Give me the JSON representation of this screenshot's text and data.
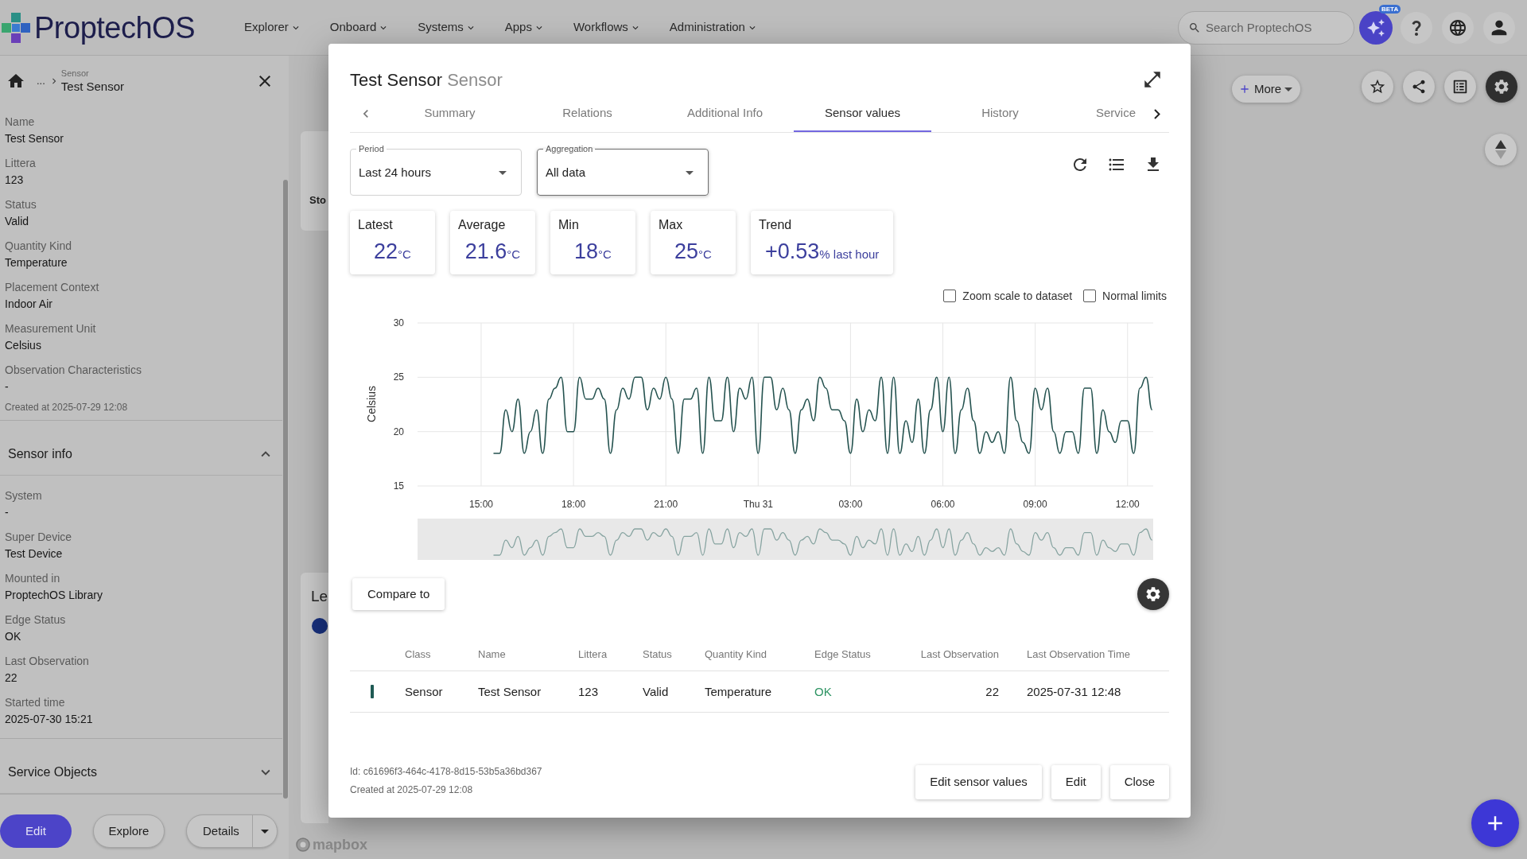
{
  "top_bar": {
    "logo": "ProptechOS",
    "nav": [
      "Explorer",
      "Onboard",
      "Systems",
      "Apps",
      "Workflows",
      "Administration"
    ],
    "search": {
      "placeholder": "Search ProptechOS"
    },
    "ai_badge": "BETA"
  },
  "side_panel": {
    "breadcrumb": {
      "ellipsis": "...",
      "type": "Sensor",
      "title": "Test Sensor"
    },
    "fields": [
      {
        "label": "Name",
        "value": "Test Sensor"
      },
      {
        "label": "Littera",
        "value": "123"
      },
      {
        "label": "Status",
        "value": "Valid"
      },
      {
        "label": "Quantity Kind",
        "value": "Temperature"
      },
      {
        "label": "Placement Context",
        "value": "Indoor Air"
      },
      {
        "label": "Measurement Unit",
        "value": "Celsius"
      },
      {
        "label": "Observation Characteristics",
        "value": "-"
      }
    ],
    "created": "Created at 2025-07-29 12:08",
    "sections": [
      {
        "title": "Sensor info",
        "expanded": true,
        "fields": [
          {
            "label": "System",
            "value": "-"
          },
          {
            "label": "Super Device",
            "value": "Test Device"
          },
          {
            "label": "Mounted in",
            "value": "ProptechOS Library"
          },
          {
            "label": "Edge Status",
            "value": "OK"
          },
          {
            "label": "Last Observation",
            "value": "22"
          },
          {
            "label": "Started time",
            "value": "2025-07-30 15:21"
          }
        ]
      },
      {
        "title": "Service Objects",
        "expanded": false
      }
    ],
    "buttons": [
      {
        "kind": "primary",
        "label": "Edit"
      },
      {
        "kind": "outline",
        "label": "Explore"
      },
      {
        "kind": "split",
        "label": "Details"
      }
    ]
  },
  "map": {
    "cards": [
      {
        "title": "Sto",
        "marker": false
      },
      {
        "title": "Le",
        "marker": true
      }
    ],
    "more_button": "More",
    "attribution": "mapbox"
  },
  "dialog": {
    "title": "Test Sensor",
    "subtitle": "Sensor",
    "tabs": [
      {
        "label": "Summary",
        "selected": false
      },
      {
        "label": "Relations",
        "selected": false
      },
      {
        "label": "Additional Info",
        "selected": false
      },
      {
        "label": "Sensor values",
        "selected": true
      },
      {
        "label": "History",
        "selected": false
      },
      {
        "label": "Service",
        "selected": false
      }
    ],
    "filters": [
      {
        "label": "Period",
        "value": "Last 24 hours",
        "focused": false
      },
      {
        "label": "Aggregation",
        "value": "All data",
        "focused": true
      }
    ],
    "stats": [
      {
        "label": "Latest",
        "value": "22",
        "unit": "°C"
      },
      {
        "label": "Average",
        "value": "21.6",
        "unit": "°C"
      },
      {
        "label": "Min",
        "value": "18",
        "unit": "°C"
      },
      {
        "label": "Max",
        "value": "25",
        "unit": "°C"
      },
      {
        "label": "Trend",
        "value": "+0.53",
        "unit": "% last hour"
      }
    ],
    "options": [
      {
        "label": "Zoom scale to dataset",
        "checked": false
      },
      {
        "label": "Normal limits",
        "checked": false
      }
    ],
    "chart_data": {
      "type": "line",
      "ylabel": "Celsius",
      "grid": true,
      "xlim": [
        "2025-07-30 12:56",
        "2025-07-31 12:50"
      ],
      "ylim": [
        15,
        30
      ],
      "yticks": [
        15,
        20,
        25,
        30
      ],
      "xticks": [
        {
          "value": "2025-07-30 15:00",
          "label": "15:00"
        },
        {
          "value": "2025-07-30 18:00",
          "label": "18:00"
        },
        {
          "value": "2025-07-30 21:00",
          "label": "21:00"
        },
        {
          "value": "2025-07-31 00:00",
          "label": "Thu 31"
        },
        {
          "value": "2025-07-31 03:00",
          "label": "03:00"
        },
        {
          "value": "2025-07-31 06:00",
          "label": "06:00"
        },
        {
          "value": "2025-07-31 09:00",
          "label": "09:00"
        },
        {
          "value": "2025-07-31 12:00",
          "label": "12:00"
        }
      ],
      "x": [
        "2025-07-30 15:24",
        "2025-07-30 15:36",
        "2025-07-30 15:48",
        "2025-07-30 16:00",
        "2025-07-30 16:12",
        "2025-07-30 16:24",
        "2025-07-30 16:36",
        "2025-07-30 16:48",
        "2025-07-30 17:00",
        "2025-07-30 17:12",
        "2025-07-30 17:24",
        "2025-07-30 17:36",
        "2025-07-30 17:48",
        "2025-07-30 18:00",
        "2025-07-30 18:12",
        "2025-07-30 18:24",
        "2025-07-30 18:36",
        "2025-07-30 18:48",
        "2025-07-30 19:00",
        "2025-07-30 19:12",
        "2025-07-30 19:24",
        "2025-07-30 19:36",
        "2025-07-30 19:48",
        "2025-07-30 20:00",
        "2025-07-30 20:12",
        "2025-07-30 20:24",
        "2025-07-30 20:36",
        "2025-07-30 20:48",
        "2025-07-30 21:00",
        "2025-07-30 21:12",
        "2025-07-30 21:24",
        "2025-07-30 21:36",
        "2025-07-30 21:48",
        "2025-07-30 22:00",
        "2025-07-30 22:12",
        "2025-07-30 22:24",
        "2025-07-30 22:36",
        "2025-07-30 22:48",
        "2025-07-30 23:00",
        "2025-07-30 23:12",
        "2025-07-30 23:24",
        "2025-07-30 23:36",
        "2025-07-30 23:48",
        "2025-07-31 00:00",
        "2025-07-31 00:12",
        "2025-07-31 00:24",
        "2025-07-31 00:36",
        "2025-07-31 00:48",
        "2025-07-31 01:00",
        "2025-07-31 01:12",
        "2025-07-31 01:24",
        "2025-07-31 01:36",
        "2025-07-31 01:48",
        "2025-07-31 02:00",
        "2025-07-31 02:12",
        "2025-07-31 02:24",
        "2025-07-31 02:36",
        "2025-07-31 02:48",
        "2025-07-31 03:00",
        "2025-07-31 03:12",
        "2025-07-31 03:24",
        "2025-07-31 03:36",
        "2025-07-31 03:48",
        "2025-07-31 04:00",
        "2025-07-31 04:12",
        "2025-07-31 04:24",
        "2025-07-31 04:36",
        "2025-07-31 04:48",
        "2025-07-31 05:00",
        "2025-07-31 05:12",
        "2025-07-31 05:24",
        "2025-07-31 05:36",
        "2025-07-31 05:48",
        "2025-07-31 06:00",
        "2025-07-31 06:12",
        "2025-07-31 06:24",
        "2025-07-31 06:36",
        "2025-07-31 06:48",
        "2025-07-31 07:00",
        "2025-07-31 07:12",
        "2025-07-31 07:24",
        "2025-07-31 07:36",
        "2025-07-31 07:48",
        "2025-07-31 08:00",
        "2025-07-31 08:12",
        "2025-07-31 08:24",
        "2025-07-31 08:36",
        "2025-07-31 08:48",
        "2025-07-31 09:00",
        "2025-07-31 09:12",
        "2025-07-31 09:24",
        "2025-07-31 09:36",
        "2025-07-31 09:48",
        "2025-07-31 10:00",
        "2025-07-31 10:12",
        "2025-07-31 10:24",
        "2025-07-31 10:36",
        "2025-07-31 10:48",
        "2025-07-31 11:00",
        "2025-07-31 11:12",
        "2025-07-31 11:24",
        "2025-07-31 11:36",
        "2025-07-31 11:48",
        "2025-07-31 12:00",
        "2025-07-31 12:12",
        "2025-07-31 12:24",
        "2025-07-31 12:36",
        "2025-07-31 12:48"
      ],
      "values": [
        18,
        18,
        22,
        20,
        23,
        18,
        20,
        22,
        18,
        23,
        24,
        25,
        20,
        20,
        25,
        23,
        23,
        24,
        23,
        18,
        22,
        24,
        23,
        25,
        25,
        22,
        24,
        23,
        25,
        23,
        18,
        23,
        23,
        24,
        18,
        25,
        21,
        21,
        25,
        20,
        24,
        23,
        25,
        18,
        25,
        25,
        22,
        24,
        22,
        18,
        22,
        23,
        21,
        25,
        24,
        22,
        22,
        21,
        18,
        23,
        20,
        22,
        21,
        25,
        18,
        25,
        18,
        21,
        19,
        23,
        18,
        22,
        25,
        20,
        25,
        18,
        22,
        24,
        21,
        18,
        20,
        19,
        20,
        18,
        25,
        21,
        19,
        18,
        24,
        22,
        24,
        20,
        18,
        20,
        20,
        18,
        24,
        24,
        18,
        22,
        20,
        19,
        21,
        21,
        18,
        24,
        25,
        22
      ]
    },
    "compare_button": "Compare to",
    "table": {
      "columns": [
        "Class",
        "Name",
        "Littera",
        "Status",
        "Quantity Kind",
        "Edge Status",
        "Last Observation",
        "Last Observation Time"
      ],
      "rows": [
        {
          "color": "#1f5a54",
          "cells": [
            {
              "text": "Sensor"
            },
            {
              "text": "Test Sensor"
            },
            {
              "text": "123"
            },
            {
              "text": "Valid"
            },
            {
              "text": "Temperature"
            },
            {
              "text": "OK",
              "color": "#2e9463"
            },
            {
              "text": "22"
            },
            {
              "text": "2025-07-31 12:48"
            }
          ]
        }
      ]
    },
    "footer": {
      "id": "Id: c61696f3-464c-4178-8d15-53b5a36bd367",
      "created": "Created at 2025-07-29 12:08"
    },
    "actions": [
      "Edit sensor values",
      "Edit",
      "Close"
    ]
  }
}
